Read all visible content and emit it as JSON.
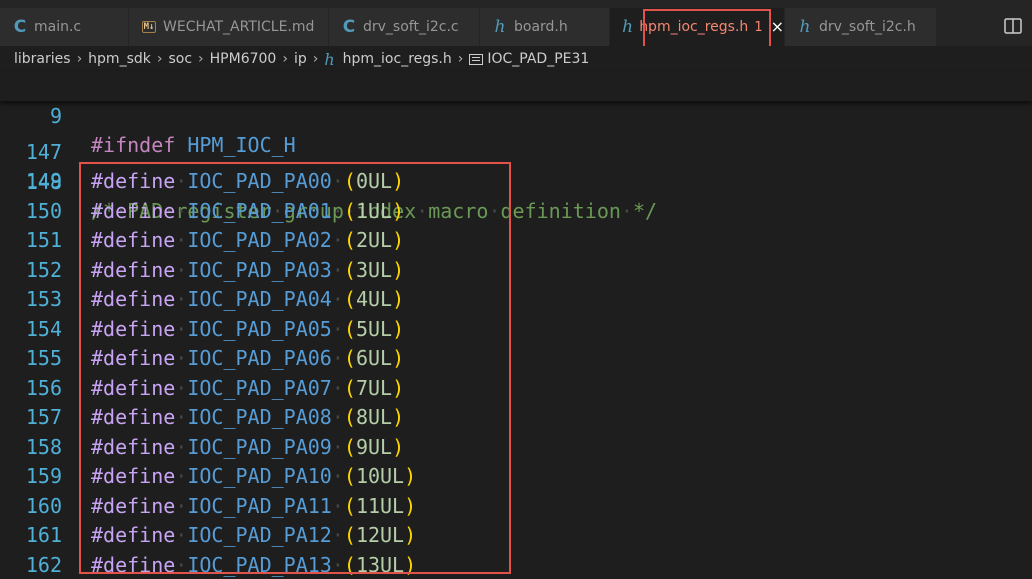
{
  "tabs": [
    {
      "label": "main.c",
      "icon": "c-file-icon"
    },
    {
      "label": "WECHAT_ARTICLE.md",
      "icon": "markdown-file-icon"
    },
    {
      "label": "drv_soft_i2c.c",
      "icon": "c-file-icon"
    },
    {
      "label": "board.h",
      "icon": "h-file-icon"
    },
    {
      "label": "hpm_ioc_regs.h",
      "icon": "h-file-icon",
      "badge": "1",
      "close": "×",
      "active": true
    },
    {
      "label": "drv_soft_i2c.h",
      "icon": "h-file-icon"
    }
  ],
  "icon_glyphs": {
    "c": "C",
    "h": "h",
    "md": "M↓"
  },
  "breadcrumb": {
    "items": [
      "libraries",
      "hpm_sdk",
      "soc",
      "HPM6700",
      "ip",
      "hpm_ioc_regs.h",
      "IOC_PAD_PE31"
    ],
    "separator": "›"
  },
  "sticky_line": {
    "number": "9",
    "keyword": "#ifndef",
    "name": "HPM_IOC_H"
  },
  "comment_line": {
    "number": "148",
    "text": "/* PAD register group index macro definition */"
  },
  "blank_line": {
    "number": "147"
  },
  "defines": [
    {
      "number": "149",
      "keyword": "#define",
      "name": "IOC_PAD_PA00",
      "value": "0UL"
    },
    {
      "number": "150",
      "keyword": "#define",
      "name": "IOC_PAD_PA01",
      "value": "1UL"
    },
    {
      "number": "151",
      "keyword": "#define",
      "name": "IOC_PAD_PA02",
      "value": "2UL"
    },
    {
      "number": "152",
      "keyword": "#define",
      "name": "IOC_PAD_PA03",
      "value": "3UL"
    },
    {
      "number": "153",
      "keyword": "#define",
      "name": "IOC_PAD_PA04",
      "value": "4UL"
    },
    {
      "number": "154",
      "keyword": "#define",
      "name": "IOC_PAD_PA05",
      "value": "5UL"
    },
    {
      "number": "155",
      "keyword": "#define",
      "name": "IOC_PAD_PA06",
      "value": "6UL"
    },
    {
      "number": "156",
      "keyword": "#define",
      "name": "IOC_PAD_PA07",
      "value": "7UL"
    },
    {
      "number": "157",
      "keyword": "#define",
      "name": "IOC_PAD_PA08",
      "value": "8UL"
    },
    {
      "number": "158",
      "keyword": "#define",
      "name": "IOC_PAD_PA09",
      "value": "9UL"
    },
    {
      "number": "159",
      "keyword": "#define",
      "name": "IOC_PAD_PA10",
      "value": "10UL"
    },
    {
      "number": "160",
      "keyword": "#define",
      "name": "IOC_PAD_PA11",
      "value": "11UL"
    },
    {
      "number": "161",
      "keyword": "#define",
      "name": "IOC_PAD_PA12",
      "value": "12UL"
    },
    {
      "number": "162",
      "keyword": "#define",
      "name": "IOC_PAD_PA13",
      "value": "13UL"
    }
  ],
  "colors": {
    "line_number": "#4fb0d8",
    "preprocessor": "#c586c0",
    "macro_name": "#c8a4f4",
    "identifier": "#569cd6",
    "comment": "#6a9955",
    "paren": "#ffd700",
    "number": "#b5cea8",
    "annotation_box": "#e0524a"
  }
}
